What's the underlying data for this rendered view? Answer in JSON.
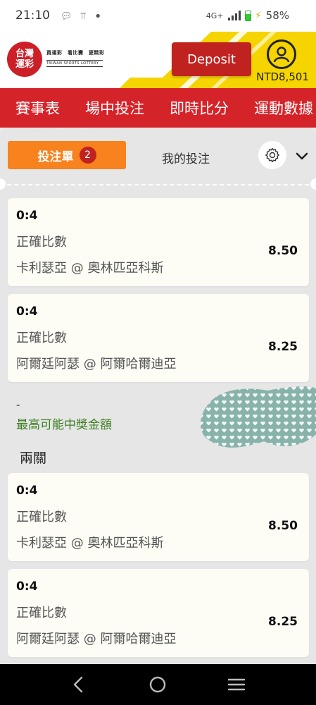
{
  "status_bar": {
    "time": "21:10",
    "network": "4G+",
    "battery": "58%"
  },
  "header": {
    "logo_text_line1": "台灣",
    "logo_text_line2": "運彩",
    "slogan": "買運彩　看比賽　更精彩",
    "logo_en": "TAIWAN SPORTS LOTTERY",
    "deposit_label": "Deposit",
    "balance": "NTD8,501",
    "colors": {
      "accent_yellow": "#f5d400",
      "brand_red": "#d5232a"
    }
  },
  "nav": {
    "items": [
      "賽事表",
      "場中投注",
      "即時比分",
      "運動數據"
    ]
  },
  "slip": {
    "tab_active_label": "投注單",
    "tab_active_count": "2",
    "tab_mybets_label": "我的投注",
    "gear_icon": "gear-icon",
    "chevron_icon": "chevron-down-icon"
  },
  "bets": [
    {
      "score": "0:4",
      "market": "正確比數",
      "match": "卡利瑟亞 @ 奧林匹亞科斯",
      "odds": "8.50"
    },
    {
      "score": "0:4",
      "market": "正確比數",
      "match": "阿爾廷阿瑟 @ 阿爾哈爾迪亞",
      "odds": "8.25"
    }
  ],
  "payout": {
    "value": "-",
    "label": "最高可能中獎金額"
  },
  "parlay": {
    "title": "兩關",
    "bets": [
      {
        "score": "0:4",
        "market": "正確比數",
        "match": "卡利瑟亞 @ 奧林匹亞科斯",
        "odds": "8.50"
      },
      {
        "score": "0:4",
        "market": "正確比數",
        "match": "阿爾廷阿瑟 @ 阿爾哈爾迪亞",
        "odds": "8.25"
      }
    ]
  }
}
